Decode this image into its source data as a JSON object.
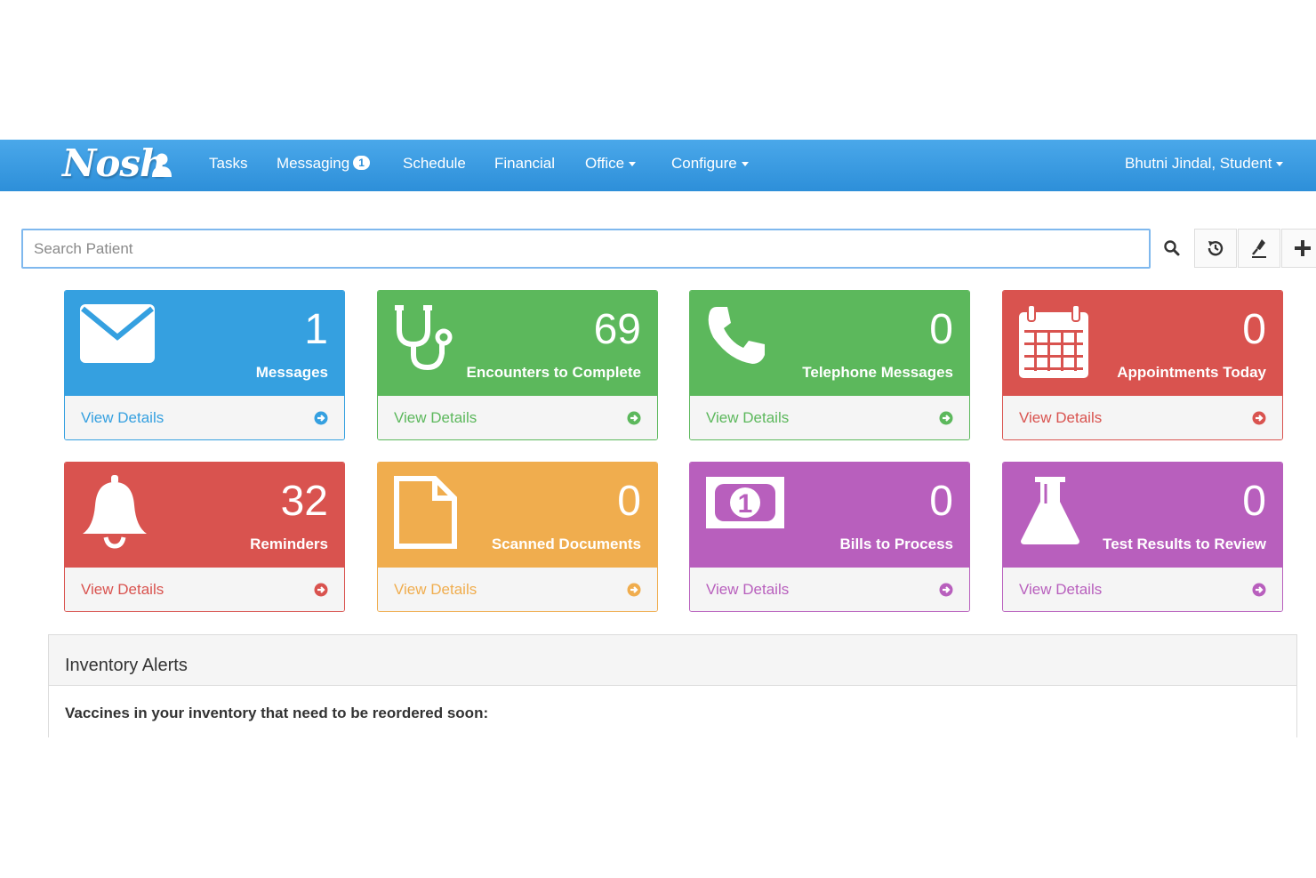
{
  "brand": "Nosh",
  "nav": {
    "tasks": "Tasks",
    "messaging": "Messaging",
    "messaging_badge": "1",
    "schedule": "Schedule",
    "financial": "Financial",
    "office": "Office",
    "configure": "Configure",
    "user": "Bhutni Jindal, Student"
  },
  "search": {
    "placeholder": "Search Patient"
  },
  "toolbar_icons": [
    "search-icon",
    "history-icon",
    "pin-icon",
    "plus-icon"
  ],
  "tiles": [
    {
      "count": "1",
      "label": "Messages",
      "link": "View Details",
      "color": "#35a0e0",
      "icon": "envelope-icon"
    },
    {
      "count": "69",
      "label": "Encounters to Complete",
      "link": "View Details",
      "color": "#5cb85c",
      "icon": "stethoscope-icon"
    },
    {
      "count": "0",
      "label": "Telephone Messages",
      "link": "View Details",
      "color": "#5cb85c",
      "icon": "phone-icon"
    },
    {
      "count": "0",
      "label": "Appointments Today",
      "link": "View Details",
      "color": "#d9534f",
      "icon": "calendar-icon"
    },
    {
      "count": "32",
      "label": "Reminders",
      "link": "View Details",
      "color": "#d9534f",
      "icon": "bell-icon"
    },
    {
      "count": "0",
      "label": "Scanned Documents",
      "link": "View Details",
      "color": "#f0ad4e",
      "icon": "document-icon"
    },
    {
      "count": "0",
      "label": "Bills to Process",
      "link": "View Details",
      "color": "#b85fbd",
      "icon": "money-icon"
    },
    {
      "count": "0",
      "label": "Test Results to Review",
      "link": "View Details",
      "color": "#b85fbd",
      "icon": "flask-icon"
    }
  ],
  "inventory": {
    "title": "Inventory Alerts",
    "text": "Vaccines in your inventory that need to be reordered soon:"
  }
}
